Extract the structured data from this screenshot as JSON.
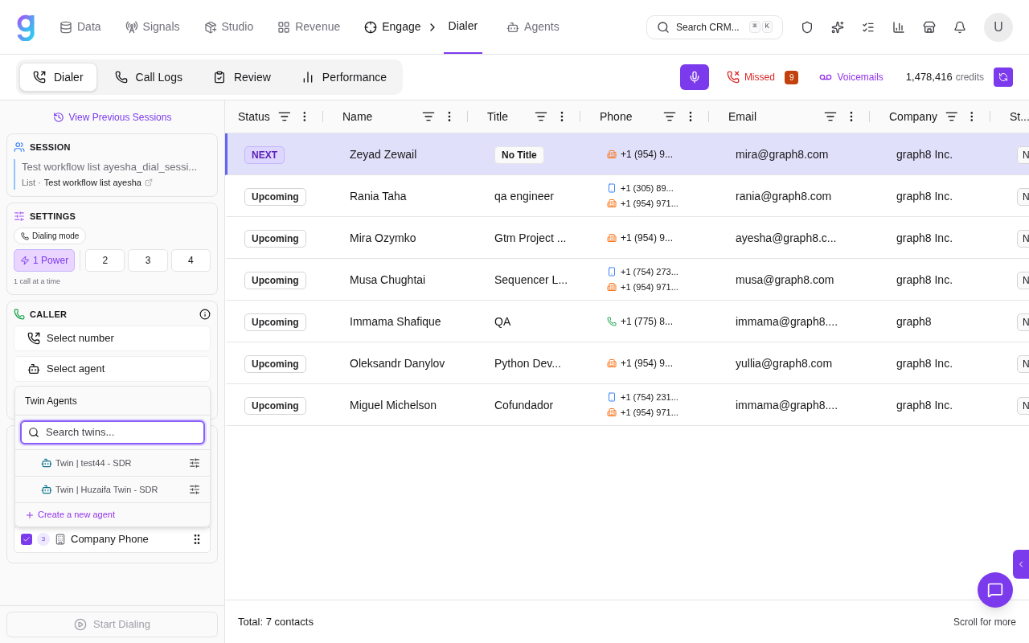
{
  "nav": {
    "items": [
      {
        "label": "Data",
        "selected": false
      },
      {
        "label": "Signals",
        "selected": false
      },
      {
        "label": "Studio",
        "selected": false
      },
      {
        "label": "Revenue",
        "selected": false
      },
      {
        "label": "Engage",
        "selected": true,
        "child": "Dialer"
      },
      {
        "label": "Agents",
        "selected": false
      }
    ],
    "search": {
      "placeholder": "Search CRM...",
      "keys": [
        "⌘",
        "K"
      ]
    },
    "avatar": "U"
  },
  "subtabs": [
    {
      "label": "Dialer",
      "selected": true
    },
    {
      "label": "Call Logs",
      "selected": false
    },
    {
      "label": "Review",
      "selected": false
    },
    {
      "label": "Performance",
      "selected": false
    }
  ],
  "toolbar": {
    "missed": "Missed",
    "missed_count": "9",
    "voicemails": "Voicemails",
    "credits": "1,478,416",
    "credits_label": "credits"
  },
  "sidebar": {
    "previous_sessions": "View Previous Sessions",
    "session": {
      "heading": "SESSION",
      "name": "Test workflow list ayesha_dial_sessi...",
      "list_label": "List ·",
      "list_name": "Test workflow list ayesha"
    },
    "settings": {
      "heading": "SETTINGS",
      "mode_label": "Dialing mode",
      "modes": [
        {
          "label": "1 Power",
          "selected": true
        },
        {
          "label": "2",
          "selected": false
        },
        {
          "label": "3",
          "selected": false
        },
        {
          "label": "4",
          "selected": false
        }
      ],
      "hint": "1 call at a time"
    },
    "caller": {
      "heading": "CALLER",
      "select_number": "Select number",
      "select_agent": "Select agent"
    },
    "agent_menu": {
      "title": "Twin Agents",
      "search_placeholder": "Search twins...",
      "agents": [
        "Twin | test44 - SDR",
        "Twin | Huzaifa Twin - SDR"
      ],
      "create": "Create a new agent"
    },
    "phone_types": [
      {
        "label": "Company Phone",
        "count": "3",
        "checked": true
      }
    ],
    "start": "Start Dialing"
  },
  "table": {
    "columns": [
      "Status",
      "Name",
      "Title",
      "Phone",
      "Email",
      "Company",
      "St..."
    ],
    "rows": [
      {
        "status": "NEXT",
        "selected": true,
        "name": "Zeyad Zewail",
        "title": {
          "kind": "badge",
          "text": "No Title"
        },
        "phones": [
          {
            "kind": "office",
            "number": "+1 (954) 9..."
          }
        ],
        "email": "mira@graph8.com",
        "company": "graph8 Inc.",
        "column_7": "N"
      },
      {
        "status": "Upcoming",
        "selected": false,
        "name": "Rania Taha",
        "title": {
          "kind": "text",
          "text": "qa engineer"
        },
        "phones": [
          {
            "kind": "mobile",
            "number": "+1 (305) 89..."
          },
          {
            "kind": "office",
            "number": "+1 (954) 971..."
          }
        ],
        "email": "rania@graph8.com",
        "company": "graph8 Inc.",
        "column_7": "N"
      },
      {
        "status": "Upcoming",
        "selected": false,
        "name": "Mira Ozymko",
        "title": {
          "kind": "text",
          "text": "Gtm Project ..."
        },
        "phones": [
          {
            "kind": "office",
            "number": "+1 (954) 9..."
          }
        ],
        "email": "ayesha@graph8.c...",
        "company": "graph8 Inc.",
        "column_7": "N"
      },
      {
        "status": "Upcoming",
        "selected": false,
        "name": "Musa Chughtai",
        "title": {
          "kind": "text",
          "text": "Sequencer L..."
        },
        "phones": [
          {
            "kind": "mobile",
            "number": "+1 (754) 273..."
          },
          {
            "kind": "office",
            "number": "+1 (954) 971..."
          }
        ],
        "email": "musa@graph8.com",
        "company": "graph8 Inc.",
        "column_7": "N"
      },
      {
        "status": "Upcoming",
        "selected": false,
        "name": "Immama Shafique",
        "title": {
          "kind": "text",
          "text": "QA"
        },
        "phones": [
          {
            "kind": "phone",
            "number": "+1 (775) 8..."
          }
        ],
        "email": "immama@graph8....",
        "company": "graph8",
        "column_7": "N"
      },
      {
        "status": "Upcoming",
        "selected": false,
        "name": "Oleksandr Danylov",
        "title": {
          "kind": "text",
          "text": "Python Dev..."
        },
        "phones": [
          {
            "kind": "office",
            "number": "+1 (954) 9..."
          }
        ],
        "email": "yullia@graph8.com",
        "company": "graph8 Inc.",
        "column_7": "N"
      },
      {
        "status": "Upcoming",
        "selected": false,
        "name": "Miguel Michelson",
        "title": {
          "kind": "text",
          "text": "Cofundador"
        },
        "phones": [
          {
            "kind": "mobile",
            "number": "+1 (754) 231..."
          },
          {
            "kind": "office",
            "number": "+1 (954) 971..."
          }
        ],
        "email": "immama@graph8....",
        "company": "graph8 Inc.",
        "column_7": "N"
      }
    ],
    "total": "Total: 7 contacts",
    "scroll_hint": "Scroll for more"
  }
}
